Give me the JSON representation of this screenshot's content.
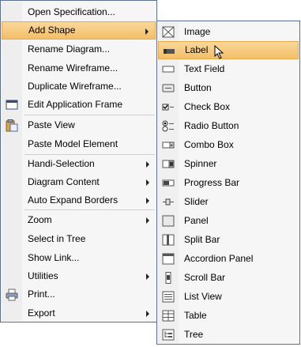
{
  "main_menu": {
    "items": [
      {
        "label": "Open Specification...",
        "submenu": false
      },
      {
        "label": "Add Shape",
        "submenu": true
      },
      {
        "label": "Rename Diagram...",
        "submenu": false
      },
      {
        "label": "Rename Wireframe...",
        "submenu": false
      },
      {
        "label": "Duplicate Wireframe...",
        "submenu": false
      },
      {
        "label": "Edit Application Frame",
        "submenu": false
      },
      {
        "label": "Paste View",
        "submenu": false
      },
      {
        "label": "Paste Model Element",
        "submenu": false
      },
      {
        "label": "Handi-Selection",
        "submenu": true
      },
      {
        "label": "Diagram Content",
        "submenu": true
      },
      {
        "label": "Auto Expand Borders",
        "submenu": true
      },
      {
        "label": "Zoom",
        "submenu": true
      },
      {
        "label": "Select in Tree",
        "submenu": false
      },
      {
        "label": "Show Link...",
        "submenu": false
      },
      {
        "label": "Utilities",
        "submenu": true
      },
      {
        "label": "Print...",
        "submenu": false
      },
      {
        "label": "Export",
        "submenu": true
      }
    ]
  },
  "sub_menu": {
    "items": [
      {
        "label": "Image"
      },
      {
        "label": "Label"
      },
      {
        "label": "Text Field"
      },
      {
        "label": "Button"
      },
      {
        "label": "Check Box"
      },
      {
        "label": "Radio Button"
      },
      {
        "label": "Combo Box"
      },
      {
        "label": "Spinner"
      },
      {
        "label": "Progress Bar"
      },
      {
        "label": "Slider"
      },
      {
        "label": "Panel"
      },
      {
        "label": "Split Bar"
      },
      {
        "label": "Accordion Panel"
      },
      {
        "label": "Scroll Bar"
      },
      {
        "label": "List View"
      },
      {
        "label": "Table"
      },
      {
        "label": "Tree"
      }
    ]
  },
  "colors": {
    "menu_border": "#5a6f93",
    "highlight": "#f3bf67",
    "menu_bg": "#f6f6f6"
  }
}
